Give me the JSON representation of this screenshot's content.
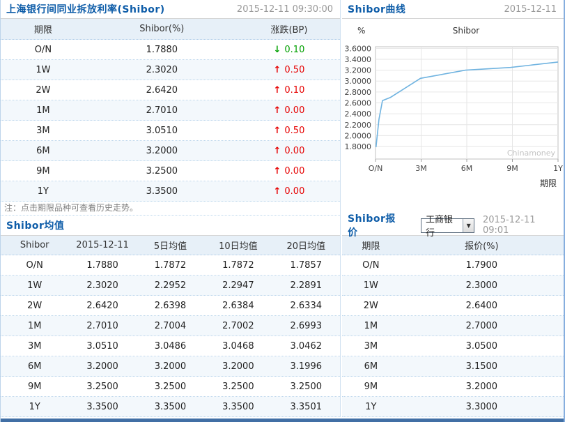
{
  "colors": {
    "accent_blue": "#0d5ca8",
    "up_red": "#e60000",
    "down_green": "#00a000",
    "line_blue": "#6fb3e0",
    "bottom_bar": "#416fa5"
  },
  "icons": {
    "up_arrow": "↑",
    "down_arrow": "↓",
    "dropdown_arrow": "▼"
  },
  "panels": {
    "rates": {
      "title": "上海银行间同业拆放利率(Shibor)",
      "timestamp": "2015-12-11 09:30:00",
      "columns": [
        "期限",
        "Shibor(%)",
        "涨跌(BP)"
      ],
      "rows": [
        {
          "term": "O/N",
          "rate": "1.7880",
          "change": "0.10",
          "dir": "down"
        },
        {
          "term": "1W",
          "rate": "2.3020",
          "change": "0.50",
          "dir": "up"
        },
        {
          "term": "2W",
          "rate": "2.6420",
          "change": "0.10",
          "dir": "up"
        },
        {
          "term": "1M",
          "rate": "2.7010",
          "change": "0.00",
          "dir": "up"
        },
        {
          "term": "3M",
          "rate": "3.0510",
          "change": "0.50",
          "dir": "up"
        },
        {
          "term": "6M",
          "rate": "3.2000",
          "change": "0.00",
          "dir": "up"
        },
        {
          "term": "9M",
          "rate": "3.2500",
          "change": "0.00",
          "dir": "up"
        },
        {
          "term": "1Y",
          "rate": "3.3500",
          "change": "0.00",
          "dir": "up"
        }
      ],
      "note": "注：点击期限品种可查看历史走势。"
    },
    "curve": {
      "title": "Shibor曲线",
      "date": "2015-12-11"
    },
    "means": {
      "title": "Shibor均值",
      "columns": [
        "Shibor",
        "2015-12-11",
        "5日均值",
        "10日均值",
        "20日均值"
      ],
      "rows": [
        [
          "O/N",
          "1.7880",
          "1.7872",
          "1.7872",
          "1.7857"
        ],
        [
          "1W",
          "2.3020",
          "2.2952",
          "2.2947",
          "2.2891"
        ],
        [
          "2W",
          "2.6420",
          "2.6398",
          "2.6384",
          "2.6334"
        ],
        [
          "1M",
          "2.7010",
          "2.7004",
          "2.7002",
          "2.6993"
        ],
        [
          "3M",
          "3.0510",
          "3.0486",
          "3.0468",
          "3.0462"
        ],
        [
          "6M",
          "3.2000",
          "3.2000",
          "3.2000",
          "3.1996"
        ],
        [
          "9M",
          "3.2500",
          "3.2500",
          "3.2500",
          "3.2500"
        ],
        [
          "1Y",
          "3.3500",
          "3.3500",
          "3.3500",
          "3.3501"
        ]
      ]
    },
    "quotes": {
      "title": "Shibor报价",
      "bank_selected": "工商银行",
      "timestamp": "2015-12-11 09:01",
      "columns": [
        "期限",
        "报价(%)"
      ],
      "rows": [
        [
          "O/N",
          "1.7900"
        ],
        [
          "1W",
          "2.3000"
        ],
        [
          "2W",
          "2.6400"
        ],
        [
          "1M",
          "2.7000"
        ],
        [
          "3M",
          "3.0500"
        ],
        [
          "6M",
          "3.1500"
        ],
        [
          "9M",
          "3.2000"
        ],
        [
          "1Y",
          "3.3000"
        ]
      ]
    }
  },
  "chart_data": {
    "type": "line",
    "title": "Shibor",
    "ylabel": "%",
    "xlabel": "期限",
    "categories": [
      "O/N",
      "1W",
      "2W",
      "1M",
      "3M",
      "6M",
      "9M",
      "1Y"
    ],
    "x_days": [
      1,
      7,
      14,
      30,
      90,
      180,
      270,
      365
    ],
    "values": [
      1.788,
      2.302,
      2.642,
      2.701,
      3.051,
      3.2,
      3.25,
      3.35
    ],
    "y_ticks": [
      1.8,
      2.0,
      2.2,
      2.4,
      2.6,
      2.8,
      3.0,
      3.2,
      3.4,
      3.6
    ],
    "y_tick_decimals": 4,
    "ylim": [
      1.57,
      3.63
    ],
    "x_tick_labels": [
      "O/N",
      "3M",
      "6M",
      "9M",
      "1Y"
    ],
    "x_tick_fracs": [
      0,
      0.25,
      0.5,
      0.75,
      1
    ],
    "grid": true,
    "legend": "none",
    "line_color": "#6fb3e0",
    "watermark": "Chinamoney"
  }
}
